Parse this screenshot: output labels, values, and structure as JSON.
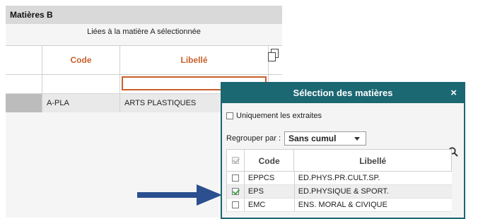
{
  "panel_a": {
    "title": "Matières B",
    "subtitle": "Liées à la matière A sélectionnée",
    "columns": {
      "code": "Code",
      "libelle": "Libellé"
    },
    "rows": [
      {
        "code": "A-PLA",
        "libelle": "ARTS PLASTIQUES"
      }
    ]
  },
  "dialog": {
    "title": "Sélection des matières",
    "close": "×",
    "only_extracted_label": "Uniquement les extraites",
    "group_by_label": "Regrouper par :",
    "group_by_value": "Sans cumul",
    "columns": {
      "code": "Code",
      "libelle": "Libellé"
    },
    "rows": [
      {
        "code": "EPPCS",
        "libelle": "ED.PHYS.PR.CULT.SP.",
        "checked": false
      },
      {
        "code": "EPS",
        "libelle": "ED.PHYSIQUE & SPORT.",
        "checked": true
      },
      {
        "code": "EMC",
        "libelle": "ENS. MORAL & CIVIQUE",
        "checked": false
      }
    ]
  },
  "colors": {
    "accent": "#c8602a",
    "dialog_header": "#1b6772",
    "arrow": "#2b4f8f",
    "check": "#3aa54a"
  }
}
